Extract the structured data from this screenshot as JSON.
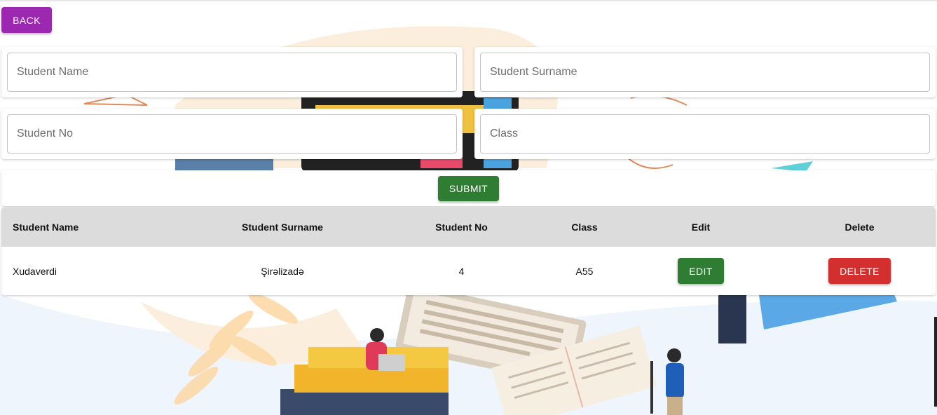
{
  "header": {
    "back_label": "BACK"
  },
  "form": {
    "student_name_placeholder": "Student Name",
    "student_surname_placeholder": "Student Surname",
    "student_no_placeholder": "Student No",
    "class_placeholder": "Class",
    "submit_label": "SUBMIT"
  },
  "table": {
    "columns": [
      "Student Name",
      "Student Surname",
      "Student No",
      "Class",
      "Edit",
      "Delete"
    ],
    "rows": [
      {
        "name": "Xudaverdi",
        "surname": "Şirəlizadə",
        "no": "4",
        "class": "A55",
        "edit_label": "EDIT",
        "delete_label": "DELETE"
      }
    ]
  },
  "colors": {
    "back": "#9c27b0",
    "submit": "#2e7d32",
    "edit": "#2e7d32",
    "delete": "#d32f2f",
    "header_bg": "#dcdcdc"
  }
}
